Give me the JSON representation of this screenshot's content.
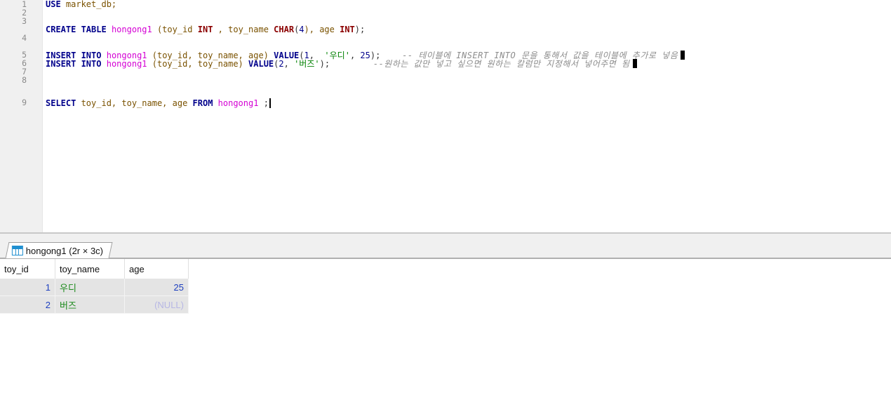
{
  "editor": {
    "line_numbers": [
      "1",
      "2",
      "3",
      "4",
      "5",
      "6",
      "7",
      "8",
      "9"
    ],
    "line1": {
      "kw": "USE",
      "db": " market_db;"
    },
    "line3": {
      "kw": "CREATE TABLE",
      "table": "hongong1",
      "p1": " (toy_id ",
      "t1": "INT",
      "p2": " , toy_name ",
      "t2": "CHAR",
      "p3": "(",
      "n1": "4",
      "p4": "), age ",
      "t3": "INT",
      "p5": ");"
    },
    "line5": {
      "kw": "INSERT INTO",
      "table": "hongong1",
      "cols": " (toy_id, toy_name, age) ",
      "fn": "VALUE",
      "p1": "(",
      "n1": "1",
      "p2": ",  ",
      "s1": "'우디'",
      "p3": ", ",
      "n2": "25",
      "p4": ");",
      "comment": "    -- 테이블에 INSERT INTO 문을 통해서 값을 테이블에 추가로 넣음"
    },
    "line6": {
      "kw": "INSERT INTO",
      "table": "hongong1",
      "cols": " (toy_id, toy_name) ",
      "fn": "VALUE",
      "p1": "(",
      "n1": "2",
      "p2": ", ",
      "s1": "'버즈'",
      "p3": ");",
      "comment": "        --원하는 값만 넣고 싶으면 원하는 칼럼만 지정해서 넣어주면 됨"
    },
    "line9": {
      "kw1": "SELECT",
      "cols": " toy_id, toy_name, age ",
      "kw2": "FROM",
      "table": " hongong1",
      "end": " ;"
    }
  },
  "results": {
    "tab_label": "hongong1 (2r × 3c)",
    "tab_icon": "table-grid-icon",
    "columns": [
      "toy_id",
      "toy_name",
      "age"
    ],
    "rows": [
      [
        "1",
        "우디",
        "25"
      ],
      [
        "2",
        "버즈",
        "(NULL)"
      ]
    ]
  },
  "colors": {
    "keyword": "#00008b",
    "table_name": "#d400d4",
    "string": "#008000",
    "comment": "#8c8c8c",
    "null_value": "#b6b6e4"
  }
}
